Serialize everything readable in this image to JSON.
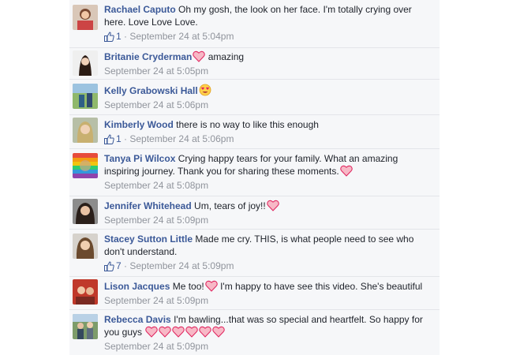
{
  "comments": [
    {
      "name": "Rachael Caputo",
      "text": "Oh my gosh, the look on her face. I'm totally crying over here. Love Love Love.",
      "likes": "1",
      "time": "September 24 at 5:04pm"
    },
    {
      "name": "Britanie Cryderman",
      "text": " amazing",
      "time": "September 24 at 5:05pm"
    },
    {
      "name": "Kelly Grabowski Hall",
      "time": "September 24 at 5:06pm"
    },
    {
      "name": "Kimberly Wood",
      "text": "there is no way to like this enough",
      "likes": "1",
      "time": "September 24 at 5:06pm"
    },
    {
      "name": "Tanya Pi Wilcox",
      "text": "Crying happy tears for your family. What an amazing inspiring journey. Thank you for sharing these moments.",
      "time": "September 24 at 5:08pm"
    },
    {
      "name": "Jennifer Whitehead",
      "text": "Um, tears of joy!!",
      "time": "September 24 at 5:09pm"
    },
    {
      "name": "Stacey Sutton Little",
      "text": "Made me cry. THIS, is what people need to see who don't understand.",
      "likes": "7",
      "time": "September 24 at 5:09pm"
    },
    {
      "name": "Lison Jacques",
      "text": "Me too!",
      "text2": " I'm happy to have see this video. She's beautiful",
      "time": "September 24 at 5:09pm"
    },
    {
      "name": "Rebecca Davis",
      "text": "I'm bawling...that was so special and heartfelt. So happy for you guys",
      "time": "September 24 at 5:09pm"
    }
  ],
  "separator": " · ",
  "icons": {
    "like": "thumbs-up-icon",
    "heart": "heart-icon",
    "heart_eyes": "heart-eyes-emoji-icon"
  },
  "colors": {
    "name": "#3b5998",
    "meta": "#90949c",
    "panel_bg": "#f6f7f9",
    "heart": "#e0245e"
  }
}
